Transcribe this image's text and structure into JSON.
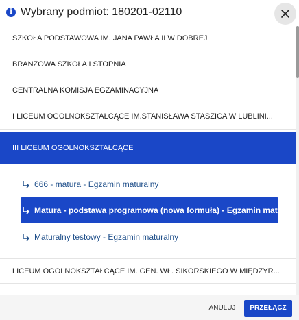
{
  "dialog": {
    "title": "Wybrany podmiot: 180201-02110",
    "close_icon": "close-icon",
    "info_icon": "info-icon"
  },
  "list": {
    "items": [
      {
        "label": "SZKOŁA PODSTAWOWA IM. JANA PAWŁA II W DOBREJ"
      },
      {
        "label": "BRANZOWA SZKOŁA I STOPNIA"
      },
      {
        "label": "CENTRALNA KOMISJA EGZAMINACYJNA"
      },
      {
        "label": "I LICEUM OGOLNOKSZTAŁCĄCE IM.STANISŁAWA STASZICA W LUBLINI..."
      },
      {
        "label": "III LICEUM OGOLNOKSZTAŁCĄCE"
      },
      {
        "label": "LICEUM OGOLNOKSZTAŁCĄCE IM. GEN. WŁ. SIKORSKIEGO W MIĘDZYR..."
      }
    ],
    "sub_items": [
      {
        "label": "666 - matura - Egzamin maturalny"
      },
      {
        "label": "Matura - podstawa programowa (nowa formuła) - Egzamin maturalny"
      },
      {
        "label": "Maturalny testowy - Egzamin maturalny"
      }
    ]
  },
  "footer": {
    "cancel_label": "ANULUJ",
    "switch_label": "PRZEŁĄCZ"
  },
  "colors": {
    "accent": "#1a47c7",
    "link": "#1f4f8a"
  }
}
